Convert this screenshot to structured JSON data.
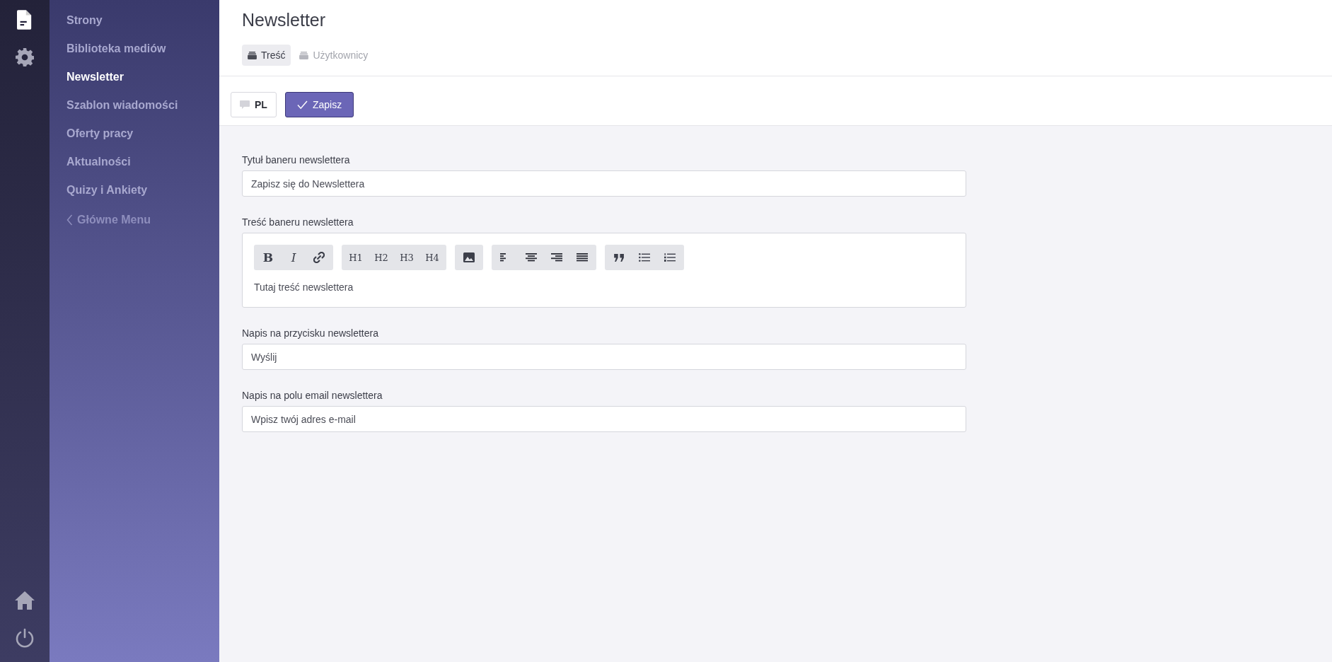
{
  "rail": {
    "top": [
      {
        "kind": "document",
        "selected": true
      },
      {
        "kind": "gear",
        "selected": false
      }
    ],
    "bottom": [
      {
        "kind": "home"
      },
      {
        "kind": "power"
      }
    ]
  },
  "sidebar": {
    "items": [
      {
        "label": "Strony",
        "selected": false
      },
      {
        "label": "Biblioteka mediów",
        "selected": false
      },
      {
        "label": "Newsletter",
        "selected": true
      },
      {
        "label": "Szablon wiadomości",
        "selected": false
      },
      {
        "label": "Oferty pracy",
        "selected": false
      },
      {
        "label": "Aktualności",
        "selected": false
      },
      {
        "label": "Quizy i Ankiety",
        "selected": false
      }
    ],
    "back_link": "Główne Menu"
  },
  "header": {
    "title": "Newsletter",
    "tabs": [
      {
        "label": "Treść",
        "selected": true
      },
      {
        "label": "Użytkownicy",
        "selected": false
      }
    ]
  },
  "actions": {
    "language": "PL",
    "save": "Zapisz"
  },
  "fields": [
    {
      "kind": "input",
      "label": "Tytuł baneru newslettera",
      "value": "Zapisz się do Newslettera"
    },
    {
      "kind": "editor",
      "label": "Treść baneru newslettera",
      "value": "Tutaj treść newslettera",
      "toolbar": [
        [
          {
            "kind": "bold",
            "label": "B"
          },
          {
            "kind": "italic",
            "label": "I"
          },
          {
            "kind": "link"
          }
        ],
        [
          {
            "kind": "text",
            "label": "H1"
          },
          {
            "kind": "text",
            "label": "H2"
          },
          {
            "kind": "text",
            "label": "H3"
          },
          {
            "kind": "text",
            "label": "H4"
          }
        ],
        [
          {
            "kind": "image"
          }
        ],
        [
          {
            "kind": "align-left"
          },
          {
            "kind": "align-center"
          },
          {
            "kind": "align-right"
          },
          {
            "kind": "justify"
          }
        ],
        [
          {
            "kind": "quote"
          },
          {
            "kind": "bullets"
          },
          {
            "kind": "numbers"
          }
        ]
      ]
    },
    {
      "kind": "input",
      "label": "Napis na przycisku newslettera",
      "value": "Wyślij"
    },
    {
      "kind": "input",
      "label": "Napis na polu email newslettera",
      "value": "Wpisz twój adres e-mail"
    }
  ]
}
